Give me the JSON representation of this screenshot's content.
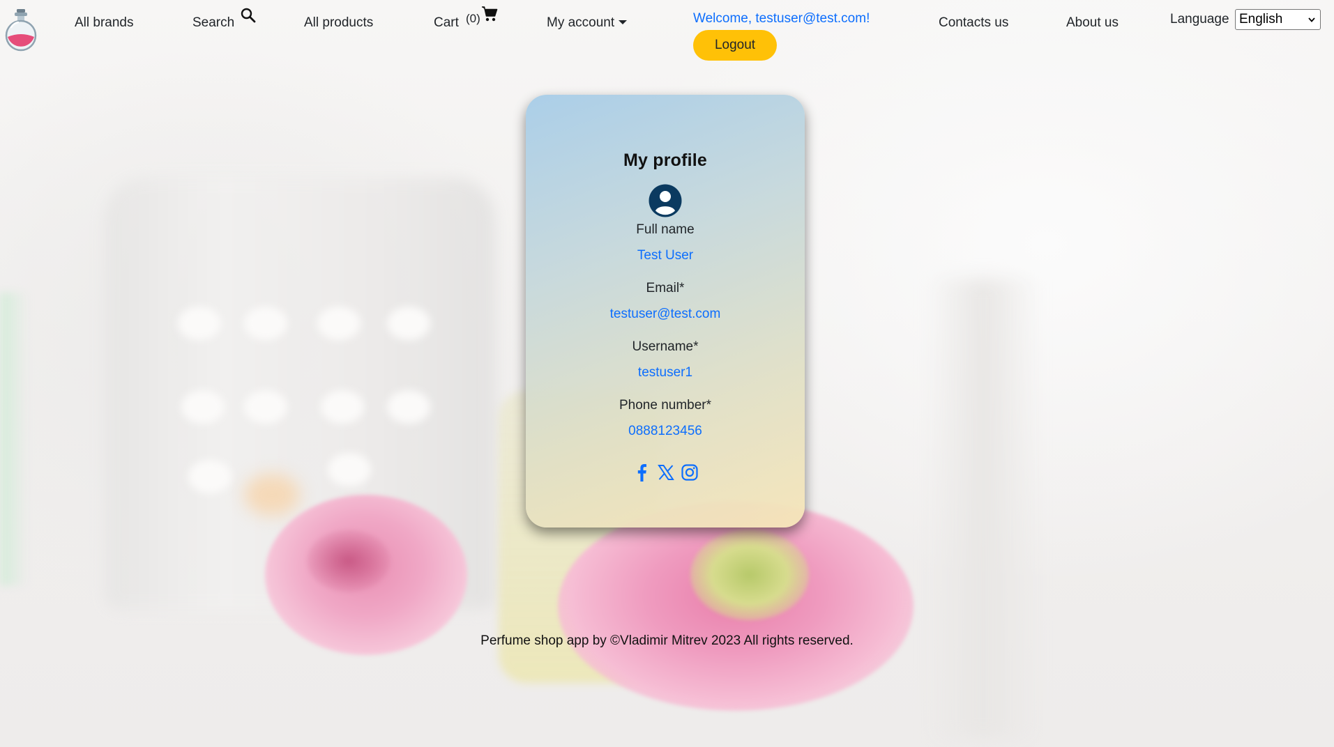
{
  "nav": {
    "all_brands": "All brands",
    "search": "Search",
    "all_products": "All products",
    "cart": "Cart",
    "cart_count": "(0)",
    "my_account": "My account",
    "welcome": "Welcome, testuser@test.com!",
    "logout": "Logout",
    "contacts": "Contacts us",
    "about": "About us",
    "language_label": "Language",
    "language_selected": "English",
    "icons": {
      "logo": "perfume-bottle-logo",
      "search": "search-icon",
      "cart": "cart-icon",
      "dropdown": "caret-down-icon"
    }
  },
  "profile": {
    "title": "My profile",
    "avatar_icon": "user-circle-icon",
    "fields": [
      {
        "label": "Full name",
        "value": "Test User"
      },
      {
        "label": "Email*",
        "value": "testuser@test.com"
      },
      {
        "label": "Username*",
        "value": "testuser1"
      },
      {
        "label": "Phone number*",
        "value": "0888123456"
      }
    ],
    "social_icons": [
      "facebook-icon",
      "x-icon",
      "instagram-icon"
    ]
  },
  "footer": {
    "text": "Perfume shop app by ©Vladimir Mitrev 2023 All rights reserved."
  },
  "colors": {
    "link_blue": "#0d6efd",
    "logout_yellow": "#ffc107",
    "avatar_navy": "#0b3a60",
    "social_blue": "#0d6efd"
  }
}
